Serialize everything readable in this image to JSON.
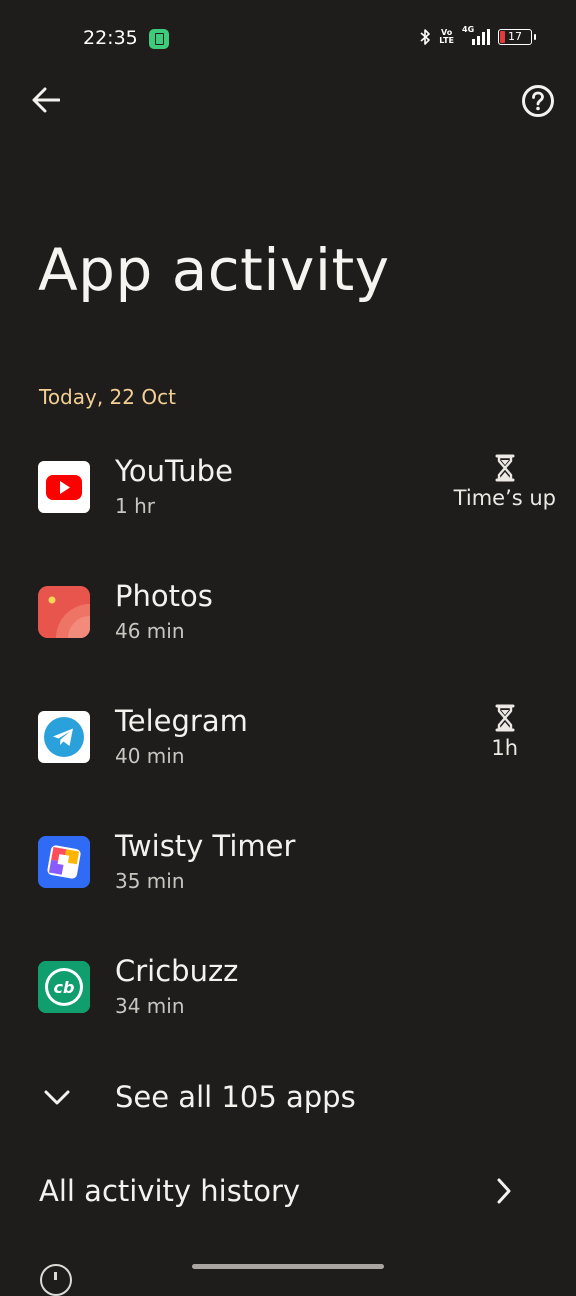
{
  "status_bar": {
    "time": "22:35",
    "volte_top": "Vo",
    "volte_bottom": "LTE",
    "network": "4G",
    "battery_level": "17",
    "battery_color": "#e23b3b"
  },
  "header": {
    "back_icon": "arrow-left-icon",
    "help_icon": "question-circle-icon"
  },
  "title": "App activity",
  "section_date": "Today, 22 Oct",
  "apps": [
    {
      "name": "YouTube",
      "time": "1 hr",
      "limit": "Time’s up",
      "icon": "youtube-icon"
    },
    {
      "name": "Photos",
      "time": "46 min",
      "limit": "",
      "icon": "photos-icon"
    },
    {
      "name": "Telegram",
      "time": "40 min",
      "limit": "1h",
      "icon": "telegram-icon"
    },
    {
      "name": "Twisty Timer",
      "time": "35 min",
      "limit": "",
      "icon": "twisty-timer-icon"
    },
    {
      "name": "Cricbuzz",
      "time": "34 min",
      "limit": "",
      "icon": "cricbuzz-icon"
    }
  ],
  "cricbuzz_icon_text": "cb",
  "see_all_label": "See all 105 apps",
  "history_label": "All activity history",
  "colors": {
    "background": "#1f1d1b",
    "accent_date": "#f2cf95",
    "youtube_red": "#ff0000",
    "photos": "#e8554c",
    "telegram": "#2aa1da",
    "cricbuzz": "#109e6f"
  }
}
